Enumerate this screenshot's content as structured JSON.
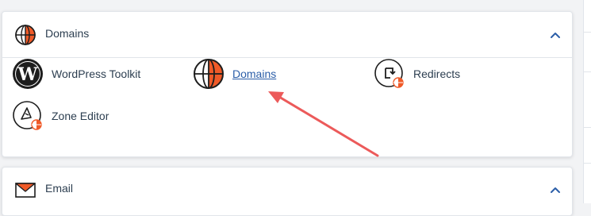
{
  "domains_section": {
    "title": "Domains",
    "header_icon": "globe-icon",
    "collapse_icon": "chevron-up-icon",
    "items": [
      {
        "label": "WordPress Toolkit",
        "icon": "wordpress-icon"
      },
      {
        "label": "Domains",
        "icon": "globe-icon"
      },
      {
        "label": "Redirects",
        "icon": "redirect-icon"
      },
      {
        "label": "Zone Editor",
        "icon": "zone-editor-icon"
      }
    ]
  },
  "email_section": {
    "title": "Email",
    "header_icon": "envelope-icon",
    "collapse_icon": "chevron-up-icon"
  },
  "colors": {
    "accent_orange": "#f05a28",
    "link_blue": "#2b5ea8",
    "annotation_arrow": "#ec5a5a",
    "text": "#2c3e50"
  },
  "annotation": {
    "type": "arrow",
    "points_to": "Domains"
  }
}
